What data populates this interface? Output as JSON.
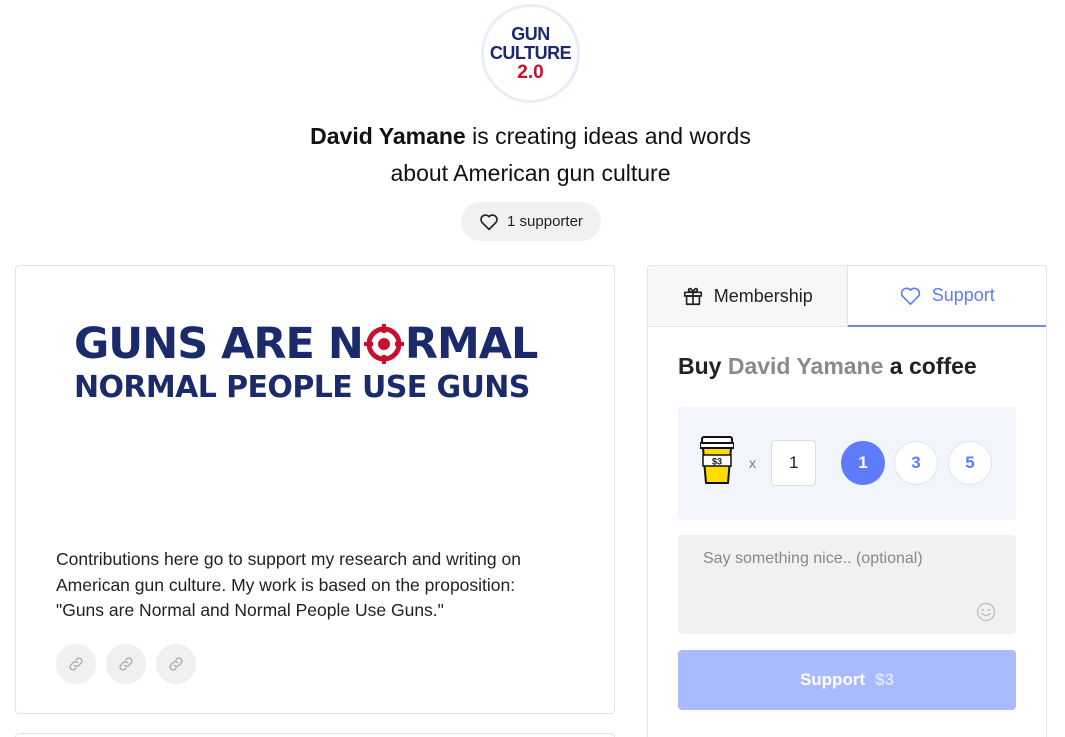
{
  "creator": {
    "logo_lines": [
      "GUN",
      "CULTURE",
      "2.0"
    ],
    "name": "David Yamane",
    "headline_rest_line1": "is creating ideas and words",
    "headline_line2": "about American gun culture",
    "supporters_label": "1 supporter"
  },
  "about": {
    "banner_line1_before": "GUNS ARE N",
    "banner_line1_after": "RMAL",
    "banner_line2": "NORMAL PEOPLE USE GUNS",
    "description_lines": [
      "Contributions here go to support my research and writing on",
      "American gun culture. My work is based on the proposition:",
      "\"Guns are Normal and Normal People Use Guns.\""
    ],
    "links": [
      "link-icon",
      "link-icon",
      "link-icon"
    ]
  },
  "tabs": [
    {
      "label": "Membership",
      "icon": "gift-icon",
      "active": false
    },
    {
      "label": "Support",
      "icon": "heart-icon",
      "active": true
    }
  ],
  "support_panel": {
    "title_prefix": "Buy",
    "title_name": "David Yamane",
    "title_suffix": "a coffee",
    "coffee_price_label": "$3",
    "times_symbol": "x",
    "quantity": "1",
    "presets": [
      "1",
      "3",
      "5"
    ],
    "selected_preset": "1",
    "message_placeholder": "Say something nice.. (optional)",
    "button_label": "Support",
    "button_amount": "$3"
  },
  "colors": {
    "accent": "#5c7cfa",
    "button_disabled": "#a9bafd",
    "navy": "#1b2a6b",
    "red": "#c8102e"
  }
}
